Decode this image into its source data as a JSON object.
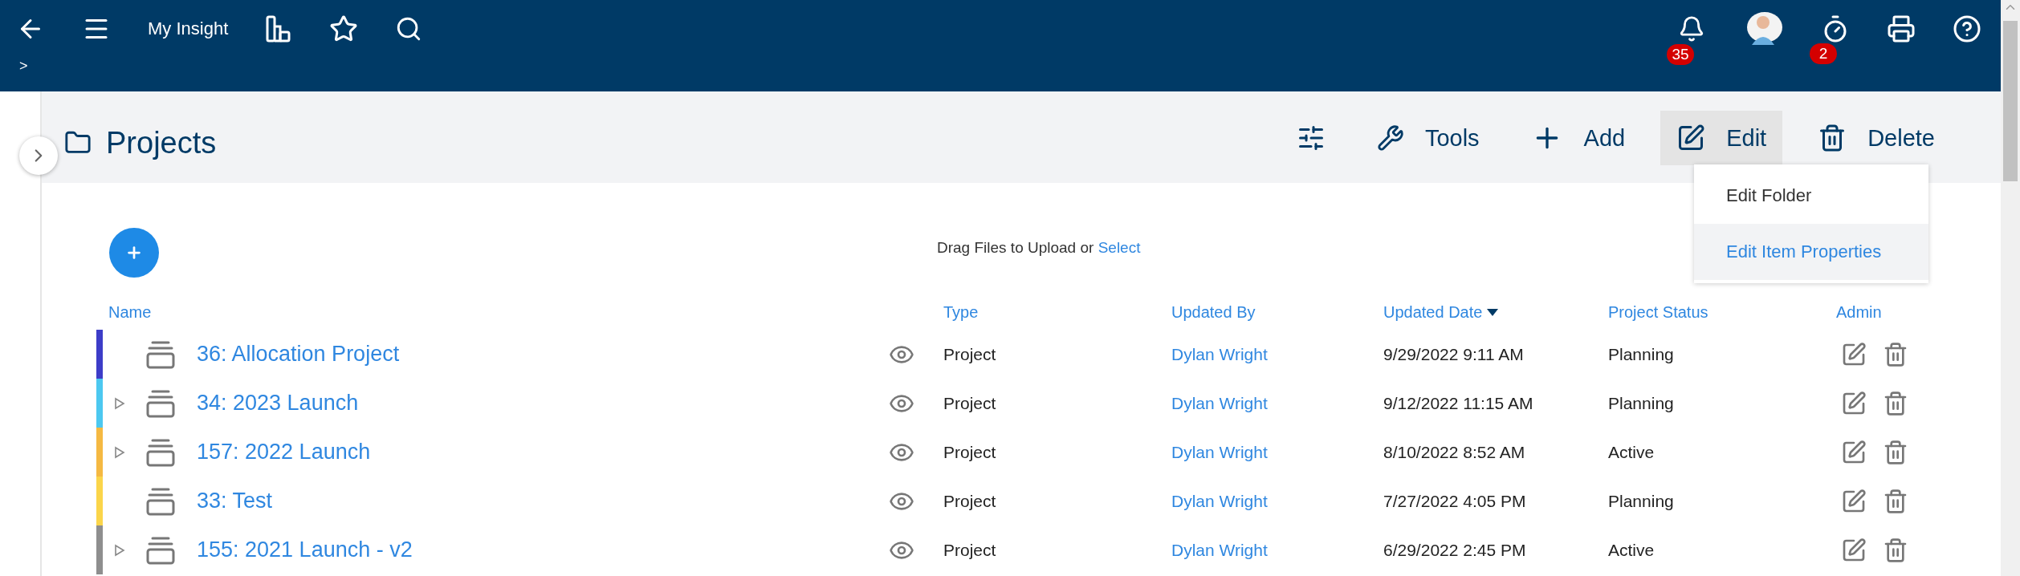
{
  "topbar": {
    "title": "My Insight",
    "notifications": "35",
    "timers": "2"
  },
  "breadcrumb": ">",
  "page": {
    "title": "Projects"
  },
  "toolbar": [
    {
      "kind": "filter",
      "selected": false
    },
    {
      "kind": "tools",
      "label": "Tools",
      "selected": false
    },
    {
      "kind": "add",
      "label": "Add",
      "selected": false
    },
    {
      "kind": "edit",
      "label": "Edit",
      "selected": true
    },
    {
      "kind": "delete",
      "label": "Delete",
      "selected": false
    }
  ],
  "edit_menu": [
    {
      "label": "Edit Folder",
      "selected": false
    },
    {
      "label": "Edit Item Properties",
      "selected": true
    }
  ],
  "upload": {
    "text": "Drag Files to Upload or",
    "link": "Select"
  },
  "table": {
    "columns": [
      {
        "label": "Name",
        "sorted": false
      },
      {
        "label": "Type",
        "sorted": false
      },
      {
        "label": "Updated By",
        "sorted": false
      },
      {
        "label": "Updated Date",
        "sorted": true
      },
      {
        "label": "Project Status",
        "sorted": false
      },
      {
        "label": "Admin",
        "sorted": false
      }
    ],
    "rows": [
      {
        "name": "36: Allocation Project",
        "expandable": false,
        "color": "#3d3dc8",
        "type": "Project",
        "updated_by": "Dylan Wright",
        "updated_date": "9/29/2022 9:11 AM",
        "status": "Planning"
      },
      {
        "name": "34: 2023 Launch",
        "expandable": true,
        "color": "#4cc8f0",
        "type": "Project",
        "updated_by": "Dylan Wright",
        "updated_date": "9/12/2022 11:15 AM",
        "status": "Planning"
      },
      {
        "name": "157: 2022 Launch",
        "expandable": true,
        "color": "#f5b942",
        "type": "Project",
        "updated_by": "Dylan Wright",
        "updated_date": "8/10/2022 8:52 AM",
        "status": "Active"
      },
      {
        "name": "33: Test",
        "expandable": false,
        "color": "#fbd54a",
        "type": "Project",
        "updated_by": "Dylan Wright",
        "updated_date": "7/27/2022 4:05 PM",
        "status": "Planning"
      },
      {
        "name": "155: 2021 Launch - v2",
        "expandable": true,
        "color": "#8e8e8e",
        "type": "Project",
        "updated_by": "Dylan Wright",
        "updated_date": "6/29/2022 2:45 PM",
        "status": "Active"
      }
    ]
  }
}
